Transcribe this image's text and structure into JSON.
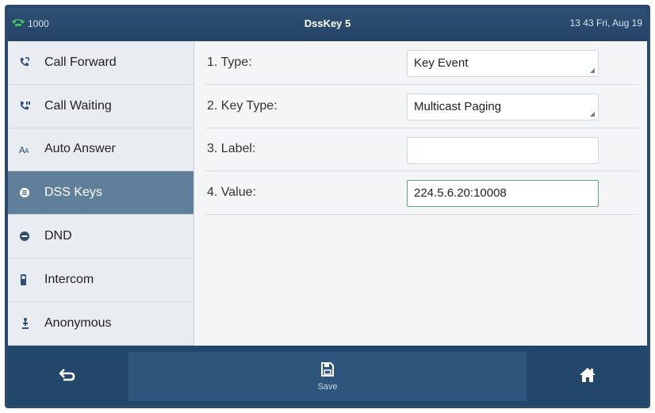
{
  "status_bar": {
    "account": "1000",
    "title": "DssKey 5",
    "datetime": "13 43 Fri, Aug 19"
  },
  "sidebar": {
    "items": [
      {
        "label": "Call Forward",
        "icon": "call-forward-icon",
        "active": false
      },
      {
        "label": "Call Waiting",
        "icon": "call-waiting-icon",
        "active": false
      },
      {
        "label": "Auto Answer",
        "icon": "auto-answer-icon",
        "active": false
      },
      {
        "label": "DSS Keys",
        "icon": "dss-keys-icon",
        "active": true
      },
      {
        "label": "DND",
        "icon": "dnd-icon",
        "active": false
      },
      {
        "label": "Intercom",
        "icon": "intercom-icon",
        "active": false
      },
      {
        "label": "Anonymous",
        "icon": "anonymous-icon",
        "active": false
      }
    ]
  },
  "form": {
    "fields": [
      {
        "label": "1. Type:",
        "value": "Key Event",
        "kind": "combo"
      },
      {
        "label": "2. Key Type:",
        "value": "Multicast Paging",
        "kind": "combo"
      },
      {
        "label": "3. Label:",
        "value": "",
        "kind": "text"
      },
      {
        "label": "4. Value:",
        "value": "224.5.6.20:10008",
        "kind": "text",
        "focused": true
      }
    ]
  },
  "softkeys": {
    "back_icon": "back-arrow-icon",
    "save_label": "Save",
    "save_icon": "save-icon",
    "home_icon": "home-icon"
  },
  "colors": {
    "accent": "#23476b",
    "active_item": "#5f7f9a",
    "focus_border": "#58a874",
    "phone_icon": "#3fc25a"
  }
}
